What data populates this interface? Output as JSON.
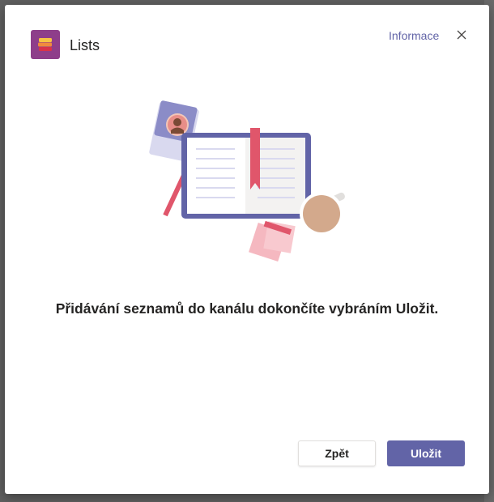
{
  "header": {
    "app_title": "Lists",
    "info_link": "Informace",
    "app_icon": "lists-app-icon",
    "close_icon": "close-icon"
  },
  "main": {
    "message": "Přidávání seznamů do kanálu dokončíte vybráním Uložit.",
    "illustration": "book-and-desk-illustration"
  },
  "footer": {
    "back_label": "Zpět",
    "save_label": "Uložit"
  },
  "colors": {
    "accent": "#6264a7",
    "app_icon_bg": "#8e3e8a",
    "bookmark": "#e0566b"
  }
}
